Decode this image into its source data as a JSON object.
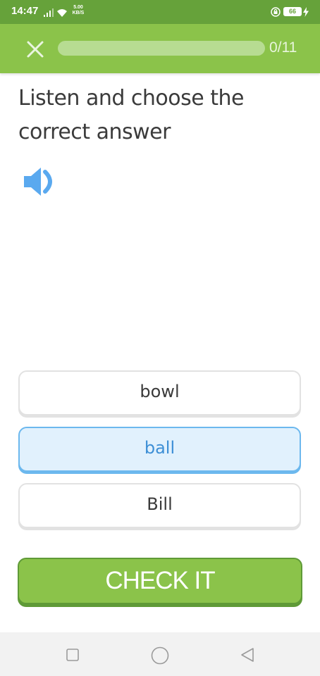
{
  "status_bar": {
    "time": "14:47",
    "net_speed_value": "5.00",
    "net_speed_unit": "KB/S",
    "battery": "66",
    "icons": [
      "signal-icon",
      "wifi-icon",
      "rotation-lock-icon",
      "battery-icon",
      "charging-icon"
    ]
  },
  "header": {
    "close_icon": "close-icon",
    "progress": {
      "current": 0,
      "total": 11,
      "fraction": 0.0
    },
    "progress_label": "0/11"
  },
  "exercise": {
    "prompt_line1": "Listen and choose the",
    "prompt_line2": "correct answer",
    "audio_icon": "speaker-icon",
    "options": [
      {
        "label": "bowl",
        "selected": false
      },
      {
        "label": "ball",
        "selected": true
      },
      {
        "label": "Bill",
        "selected": false
      }
    ],
    "check_label": "CHECK IT"
  },
  "nav_bar": {
    "icons": [
      "recent-apps-icon",
      "home-icon",
      "back-icon"
    ]
  },
  "colors": {
    "status_bar": "#66a23a",
    "header": "#8bc34a",
    "progress_track": "#b7dc92",
    "speaker": "#5aa9ef",
    "selected_bg": "#e1f1fd",
    "selected_border": "#6cb8ee",
    "button": "#8bc34a",
    "button_border": "#5f9a37"
  }
}
